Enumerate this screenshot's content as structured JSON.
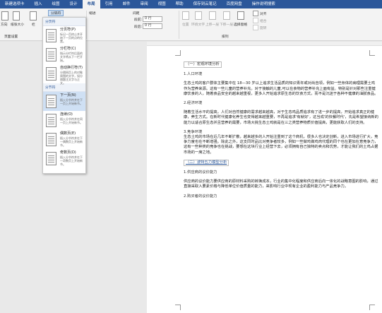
{
  "tabs": [
    "新建选项卡",
    "插入",
    "绘图",
    "设计",
    "布局",
    "引用",
    "邮件",
    "审阅",
    "视图",
    "帮助",
    "保存到云笔记",
    "百度网盘",
    "操作说明搜索"
  ],
  "active_tab_index": 4,
  "ribbon": {
    "btn_direction": "方向",
    "btn_size": "纸张大小",
    "btn_columns": "栏",
    "btn_breaks": "分隔符",
    "group_page_setup": "页面设置",
    "label_indent": "缩进",
    "label_spacing": "间距",
    "spacing_before_label": "段前:",
    "spacing_before_value": "0 行",
    "spacing_after_label": "段后:",
    "spacing_after_value": "0 行",
    "arrange_position": "位置",
    "arrange_wrap": "环绕文字",
    "arrange_forward": "上移一层",
    "arrange_backward": "下移一层",
    "arrange_pane": "选择窗格",
    "arrange_align": "对齐",
    "arrange_group": "组合",
    "arrange_rotate": "旋转",
    "group_arrange": "排列"
  },
  "dropdown": {
    "section_page": "分页符",
    "items_page": [
      {
        "title": "分页符(P)",
        "desc": "标记一页终止并开始下一页的点的位置。"
      },
      {
        "title": "分栏符(C)",
        "desc": "指示分栏符后面的文字将从下一栏开始。"
      },
      {
        "title": "自动换行符(T)",
        "desc": "分隔网页上的对象周围的文字，如分隔题注文字与正文。"
      }
    ],
    "section_section": "分节符",
    "items_section": [
      {
        "title": "下一页(N)",
        "desc": "插入分节符并在下一页上开始新节。"
      },
      {
        "title": "连续(O)",
        "desc": "插入分节符并在同一页上开始新节。"
      },
      {
        "title": "偶数页(E)",
        "desc": "插入分节符并在下一偶数页上开始新节。"
      },
      {
        "title": "奇数页(D)",
        "desc": "插入分节符并在下一奇数页上开始新节。"
      }
    ]
  },
  "document": {
    "h1": "（一）宏观环境分析",
    "h1_1": "1.人口环境",
    "p1": "生态土鸡的客户群体主要集中在 18—30 岁以上追求生活品质的知识青年或对尚自领，例如一些身体的病理需要土鸡作为营养来源。这有一些儿童的营养补充。对于接触的儿童,可以在食物的营养补充上面有益。特别是针对那些注重健康饮食的人，随着食品安全的越来越重视，更多人开始追求原生态的饮食方式，而不是沉迷于各种不健康的油腻食品。",
    "h1_2": "2.经济环境",
    "p2": "随着生活水平的提高，人们对自然健康的需求越来越高，对于生态鸡品质追求有了进一步的提高，开始追求真正的健康，养生方式。在新时代健康化养生也变得越来越重要，不再是追求'有就好'，这当成'的快餐时代'，先是希望接纳新的能力以适合原生态并且营养的需要，市场大挑生态土鸡就是在三之类营养物质价值提高，更能获取人们的支持。",
    "h1_3": "3.竞争环境",
    "p3": "生态土鸡的市场在近几年不断扩散，越来越多的人开始注重到了这个商机，很多人也决定创新，进入市场进行扩大，竞争力度也在不断增强。除此之外，这支同时品比对竞争者较多，例如一些做鸡做鸡肉代理的同个也在更加在意竞争力，这有一些种类的竞争也在挑战，要想在这块行业上经营下去，必须拥有自己独特的卖点和优势，才能让我们的土鸡占据市场的一席之地。",
    "h2": "（二）波特五力模型分析",
    "h2_1": "1.供应商的议价能力",
    "p4": "供应商的议价能力要供应商的原材料采购的转换成本，行业的集中化程度和供应商后向一体化的战略意图的影响，通过直接采取入要素价格与降低单位价值质量的能力，来影响行业中现有企业的盈利能力与产品竞争力。",
    "h2_2": "2.购买者的议价能力"
  }
}
